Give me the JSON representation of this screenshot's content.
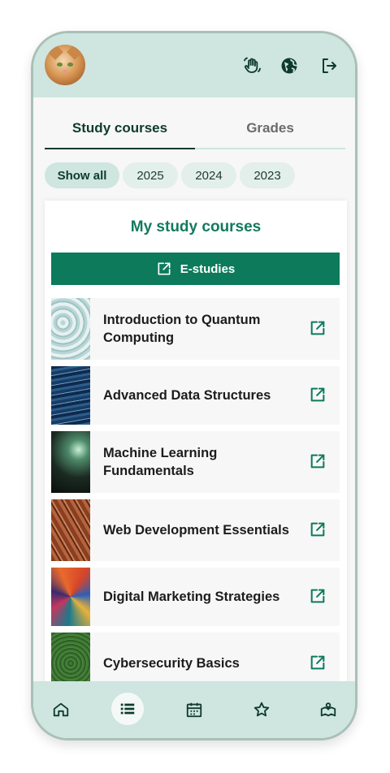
{
  "header": {
    "avatar_alt": "User profile photo",
    "icons": [
      "waving-hand-icon",
      "globe-icon",
      "logout-icon"
    ]
  },
  "tabs": [
    {
      "label": "Study courses",
      "active": true
    },
    {
      "label": "Grades",
      "active": false
    }
  ],
  "filters": [
    {
      "label": "Show all",
      "selected": true
    },
    {
      "label": "2025",
      "selected": false
    },
    {
      "label": "2024",
      "selected": false
    },
    {
      "label": "2023",
      "selected": false
    }
  ],
  "card": {
    "title": "My study courses",
    "estudies_label": "E-studies"
  },
  "courses": [
    {
      "name": "Introduction to Quantum Computing",
      "thumb": "water-texture"
    },
    {
      "name": "Advanced Data Structures",
      "thumb": "blue-fabric"
    },
    {
      "name": "Machine Learning Fundamentals",
      "thumb": "dark-glass"
    },
    {
      "name": "Web Development Essentials",
      "thumb": "red-rock"
    },
    {
      "name": "Digital Marketing Strategies",
      "thumb": "colorful-fabric"
    },
    {
      "name": "Cybersecurity Basics",
      "thumb": "green-grass"
    }
  ],
  "bottom_nav": [
    {
      "name": "home",
      "active": false
    },
    {
      "name": "list",
      "active": true
    },
    {
      "name": "calendar",
      "active": false
    },
    {
      "name": "favorites",
      "active": false
    },
    {
      "name": "map",
      "active": false
    }
  ],
  "colors": {
    "accent": "#0d7a5b",
    "header_bg": "#cfe5df",
    "title_green": "#137a5e",
    "text_dark": "#0e3b2c"
  }
}
